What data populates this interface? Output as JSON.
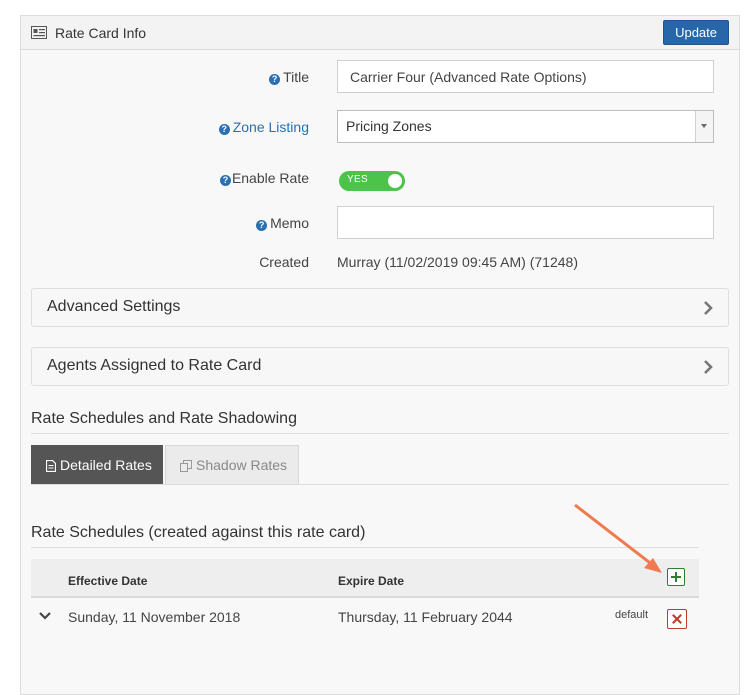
{
  "panel": {
    "title": "Rate Card Info",
    "update_label": "Update"
  },
  "form": {
    "title_label": "Title",
    "title_value": "Carrier Four (Advanced Rate Options)",
    "zone_label": "Zone Listing",
    "zone_value": "Pricing Zones",
    "enable_label": "Enable Rate",
    "enable_value": "YES",
    "memo_label": "Memo",
    "memo_value": "",
    "created_label": "Created",
    "created_value": "Murray (11/02/2019 09:45 AM) (71248)"
  },
  "sections": {
    "advanced_settings": "Advanced Settings",
    "agents_assigned": "Agents Assigned to Rate Card"
  },
  "rate_section": {
    "title": "Rate Schedules and Rate Shadowing",
    "tabs": [
      {
        "label": "Detailed Rates",
        "icon": "document-icon",
        "active": true
      },
      {
        "label": "Shadow Rates",
        "icon": "copy-icon",
        "active": false
      }
    ]
  },
  "schedules": {
    "title": "Rate Schedules (created against this rate card)",
    "columns": [
      "Effective Date",
      "Expire Date"
    ],
    "rows": [
      {
        "effective": "Sunday, 11 November 2018",
        "expire": "Thursday, 11 February 2044",
        "tag": "default"
      }
    ]
  },
  "colors": {
    "accent": "#2766a8",
    "toggle_on": "#4cc44c",
    "add": "#2f7d32",
    "delete": "#c0392b",
    "annotation_arrow": "#f07a50"
  }
}
